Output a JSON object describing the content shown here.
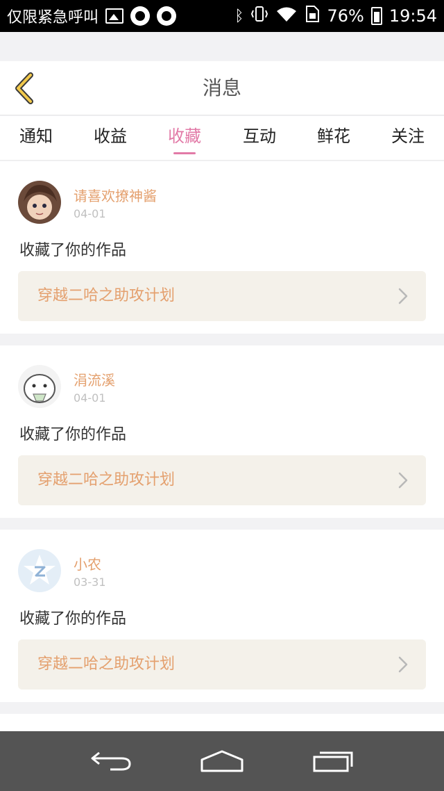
{
  "status_bar": {
    "carrier_text": "仅限紧急呼叫",
    "battery": "76%",
    "time": "19:54",
    "icons": [
      "image-icon",
      "q-app-icon",
      "q-app-icon",
      "bluetooth-icon",
      "vibrate-icon",
      "wifi-icon",
      "sim-icon",
      "battery-icon"
    ]
  },
  "header": {
    "title": "消息",
    "back_icon": "chevron-left-icon"
  },
  "tabs": [
    {
      "label": "通知"
    },
    {
      "label": "收益"
    },
    {
      "label": "收藏",
      "active": true
    },
    {
      "label": "互动"
    },
    {
      "label": "鲜花"
    },
    {
      "label": "关注"
    }
  ],
  "messages": [
    {
      "user": "请喜欢撩神酱",
      "date": "04-01",
      "action": "收藏了你的作品",
      "work_title": "穿越二哈之助攻计划"
    },
    {
      "user": "涓流溪",
      "date": "04-01",
      "action": "收藏了你的作品",
      "work_title": "穿越二哈之助攻计划"
    },
    {
      "user": "小农",
      "date": "03-31",
      "action": "收藏了你的作品",
      "work_title": "穿越二哈之助攻计划"
    }
  ],
  "colors": {
    "accent_pink": "#e27aa7",
    "username_orange": "#e4a06e",
    "back_yellow": "#f2c94c"
  },
  "navbar": [
    "back-icon",
    "home-icon",
    "recents-icon"
  ]
}
